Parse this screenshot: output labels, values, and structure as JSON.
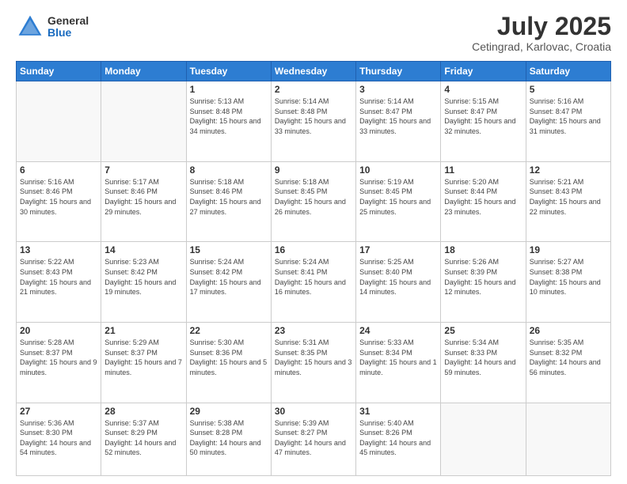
{
  "header": {
    "logo_general": "General",
    "logo_blue": "Blue",
    "month_year": "July 2025",
    "location": "Cetingrad, Karlovac, Croatia"
  },
  "weekdays": [
    "Sunday",
    "Monday",
    "Tuesday",
    "Wednesday",
    "Thursday",
    "Friday",
    "Saturday"
  ],
  "weeks": [
    [
      {
        "day": "",
        "sunrise": "",
        "sunset": "",
        "daylight": "",
        "empty": true
      },
      {
        "day": "",
        "sunrise": "",
        "sunset": "",
        "daylight": "",
        "empty": true
      },
      {
        "day": "1",
        "sunrise": "Sunrise: 5:13 AM",
        "sunset": "Sunset: 8:48 PM",
        "daylight": "Daylight: 15 hours and 34 minutes."
      },
      {
        "day": "2",
        "sunrise": "Sunrise: 5:14 AM",
        "sunset": "Sunset: 8:48 PM",
        "daylight": "Daylight: 15 hours and 33 minutes."
      },
      {
        "day": "3",
        "sunrise": "Sunrise: 5:14 AM",
        "sunset": "Sunset: 8:47 PM",
        "daylight": "Daylight: 15 hours and 33 minutes."
      },
      {
        "day": "4",
        "sunrise": "Sunrise: 5:15 AM",
        "sunset": "Sunset: 8:47 PM",
        "daylight": "Daylight: 15 hours and 32 minutes."
      },
      {
        "day": "5",
        "sunrise": "Sunrise: 5:16 AM",
        "sunset": "Sunset: 8:47 PM",
        "daylight": "Daylight: 15 hours and 31 minutes."
      }
    ],
    [
      {
        "day": "6",
        "sunrise": "Sunrise: 5:16 AM",
        "sunset": "Sunset: 8:46 PM",
        "daylight": "Daylight: 15 hours and 30 minutes."
      },
      {
        "day": "7",
        "sunrise": "Sunrise: 5:17 AM",
        "sunset": "Sunset: 8:46 PM",
        "daylight": "Daylight: 15 hours and 29 minutes."
      },
      {
        "day": "8",
        "sunrise": "Sunrise: 5:18 AM",
        "sunset": "Sunset: 8:46 PM",
        "daylight": "Daylight: 15 hours and 27 minutes."
      },
      {
        "day": "9",
        "sunrise": "Sunrise: 5:18 AM",
        "sunset": "Sunset: 8:45 PM",
        "daylight": "Daylight: 15 hours and 26 minutes."
      },
      {
        "day": "10",
        "sunrise": "Sunrise: 5:19 AM",
        "sunset": "Sunset: 8:45 PM",
        "daylight": "Daylight: 15 hours and 25 minutes."
      },
      {
        "day": "11",
        "sunrise": "Sunrise: 5:20 AM",
        "sunset": "Sunset: 8:44 PM",
        "daylight": "Daylight: 15 hours and 23 minutes."
      },
      {
        "day": "12",
        "sunrise": "Sunrise: 5:21 AM",
        "sunset": "Sunset: 8:43 PM",
        "daylight": "Daylight: 15 hours and 22 minutes."
      }
    ],
    [
      {
        "day": "13",
        "sunrise": "Sunrise: 5:22 AM",
        "sunset": "Sunset: 8:43 PM",
        "daylight": "Daylight: 15 hours and 21 minutes."
      },
      {
        "day": "14",
        "sunrise": "Sunrise: 5:23 AM",
        "sunset": "Sunset: 8:42 PM",
        "daylight": "Daylight: 15 hours and 19 minutes."
      },
      {
        "day": "15",
        "sunrise": "Sunrise: 5:24 AM",
        "sunset": "Sunset: 8:42 PM",
        "daylight": "Daylight: 15 hours and 17 minutes."
      },
      {
        "day": "16",
        "sunrise": "Sunrise: 5:24 AM",
        "sunset": "Sunset: 8:41 PM",
        "daylight": "Daylight: 15 hours and 16 minutes."
      },
      {
        "day": "17",
        "sunrise": "Sunrise: 5:25 AM",
        "sunset": "Sunset: 8:40 PM",
        "daylight": "Daylight: 15 hours and 14 minutes."
      },
      {
        "day": "18",
        "sunrise": "Sunrise: 5:26 AM",
        "sunset": "Sunset: 8:39 PM",
        "daylight": "Daylight: 15 hours and 12 minutes."
      },
      {
        "day": "19",
        "sunrise": "Sunrise: 5:27 AM",
        "sunset": "Sunset: 8:38 PM",
        "daylight": "Daylight: 15 hours and 10 minutes."
      }
    ],
    [
      {
        "day": "20",
        "sunrise": "Sunrise: 5:28 AM",
        "sunset": "Sunset: 8:37 PM",
        "daylight": "Daylight: 15 hours and 9 minutes."
      },
      {
        "day": "21",
        "sunrise": "Sunrise: 5:29 AM",
        "sunset": "Sunset: 8:37 PM",
        "daylight": "Daylight: 15 hours and 7 minutes."
      },
      {
        "day": "22",
        "sunrise": "Sunrise: 5:30 AM",
        "sunset": "Sunset: 8:36 PM",
        "daylight": "Daylight: 15 hours and 5 minutes."
      },
      {
        "day": "23",
        "sunrise": "Sunrise: 5:31 AM",
        "sunset": "Sunset: 8:35 PM",
        "daylight": "Daylight: 15 hours and 3 minutes."
      },
      {
        "day": "24",
        "sunrise": "Sunrise: 5:33 AM",
        "sunset": "Sunset: 8:34 PM",
        "daylight": "Daylight: 15 hours and 1 minute."
      },
      {
        "day": "25",
        "sunrise": "Sunrise: 5:34 AM",
        "sunset": "Sunset: 8:33 PM",
        "daylight": "Daylight: 14 hours and 59 minutes."
      },
      {
        "day": "26",
        "sunrise": "Sunrise: 5:35 AM",
        "sunset": "Sunset: 8:32 PM",
        "daylight": "Daylight: 14 hours and 56 minutes."
      }
    ],
    [
      {
        "day": "27",
        "sunrise": "Sunrise: 5:36 AM",
        "sunset": "Sunset: 8:30 PM",
        "daylight": "Daylight: 14 hours and 54 minutes."
      },
      {
        "day": "28",
        "sunrise": "Sunrise: 5:37 AM",
        "sunset": "Sunset: 8:29 PM",
        "daylight": "Daylight: 14 hours and 52 minutes."
      },
      {
        "day": "29",
        "sunrise": "Sunrise: 5:38 AM",
        "sunset": "Sunset: 8:28 PM",
        "daylight": "Daylight: 14 hours and 50 minutes."
      },
      {
        "day": "30",
        "sunrise": "Sunrise: 5:39 AM",
        "sunset": "Sunset: 8:27 PM",
        "daylight": "Daylight: 14 hours and 47 minutes."
      },
      {
        "day": "31",
        "sunrise": "Sunrise: 5:40 AM",
        "sunset": "Sunset: 8:26 PM",
        "daylight": "Daylight: 14 hours and 45 minutes."
      },
      {
        "day": "",
        "sunrise": "",
        "sunset": "",
        "daylight": "",
        "empty": true
      },
      {
        "day": "",
        "sunrise": "",
        "sunset": "",
        "daylight": "",
        "empty": true
      }
    ]
  ]
}
